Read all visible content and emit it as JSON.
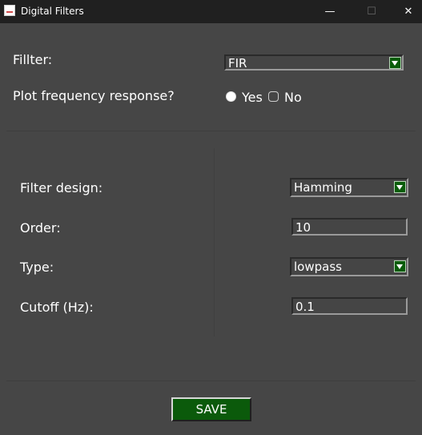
{
  "window": {
    "title": "Digital Filters",
    "minimize_glyph": "—",
    "maximize_glyph": "☐",
    "close_glyph": "✕"
  },
  "top": {
    "filter_label": "Fillter:",
    "filter_value": "FIR",
    "plot_label": "Plot frequency response?",
    "plot_options": [
      {
        "label": "Yes",
        "selected": true
      },
      {
        "label": "No",
        "selected": false
      }
    ]
  },
  "params": {
    "design_label": "Filter design:",
    "design_value": "Hamming",
    "order_label": "Order:",
    "order_value": "10",
    "type_label": "Type:",
    "type_value": "lowpass",
    "cutoff_label": "Cutoff (Hz):",
    "cutoff_value": "0.1"
  },
  "footer": {
    "save_label": "SAVE"
  },
  "colors": {
    "background": "#464646",
    "titlebar": "#202020",
    "accent_green": "#0b5a0b"
  },
  "icons": {
    "app": "app-icon",
    "dropdown": "chevron-down-icon"
  }
}
